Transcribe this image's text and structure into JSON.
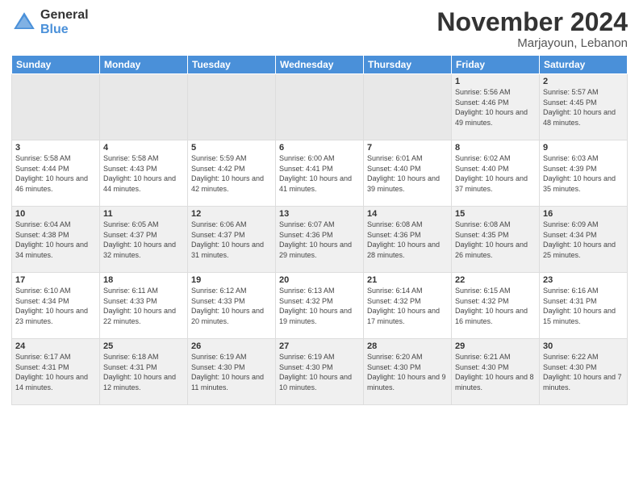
{
  "header": {
    "logo_general": "General",
    "logo_blue": "Blue",
    "month_title": "November 2024",
    "location": "Marjayoun, Lebanon"
  },
  "days_of_week": [
    "Sunday",
    "Monday",
    "Tuesday",
    "Wednesday",
    "Thursday",
    "Friday",
    "Saturday"
  ],
  "weeks": [
    [
      {
        "day": "",
        "empty": true
      },
      {
        "day": "",
        "empty": true
      },
      {
        "day": "",
        "empty": true
      },
      {
        "day": "",
        "empty": true
      },
      {
        "day": "",
        "empty": true
      },
      {
        "day": "1",
        "sunrise": "Sunrise: 5:56 AM",
        "sunset": "Sunset: 4:46 PM",
        "daylight": "Daylight: 10 hours and 49 minutes."
      },
      {
        "day": "2",
        "sunrise": "Sunrise: 5:57 AM",
        "sunset": "Sunset: 4:45 PM",
        "daylight": "Daylight: 10 hours and 48 minutes."
      }
    ],
    [
      {
        "day": "3",
        "sunrise": "Sunrise: 5:58 AM",
        "sunset": "Sunset: 4:44 PM",
        "daylight": "Daylight: 10 hours and 46 minutes."
      },
      {
        "day": "4",
        "sunrise": "Sunrise: 5:58 AM",
        "sunset": "Sunset: 4:43 PM",
        "daylight": "Daylight: 10 hours and 44 minutes."
      },
      {
        "day": "5",
        "sunrise": "Sunrise: 5:59 AM",
        "sunset": "Sunset: 4:42 PM",
        "daylight": "Daylight: 10 hours and 42 minutes."
      },
      {
        "day": "6",
        "sunrise": "Sunrise: 6:00 AM",
        "sunset": "Sunset: 4:41 PM",
        "daylight": "Daylight: 10 hours and 41 minutes."
      },
      {
        "day": "7",
        "sunrise": "Sunrise: 6:01 AM",
        "sunset": "Sunset: 4:40 PM",
        "daylight": "Daylight: 10 hours and 39 minutes."
      },
      {
        "day": "8",
        "sunrise": "Sunrise: 6:02 AM",
        "sunset": "Sunset: 4:40 PM",
        "daylight": "Daylight: 10 hours and 37 minutes."
      },
      {
        "day": "9",
        "sunrise": "Sunrise: 6:03 AM",
        "sunset": "Sunset: 4:39 PM",
        "daylight": "Daylight: 10 hours and 35 minutes."
      }
    ],
    [
      {
        "day": "10",
        "sunrise": "Sunrise: 6:04 AM",
        "sunset": "Sunset: 4:38 PM",
        "daylight": "Daylight: 10 hours and 34 minutes."
      },
      {
        "day": "11",
        "sunrise": "Sunrise: 6:05 AM",
        "sunset": "Sunset: 4:37 PM",
        "daylight": "Daylight: 10 hours and 32 minutes."
      },
      {
        "day": "12",
        "sunrise": "Sunrise: 6:06 AM",
        "sunset": "Sunset: 4:37 PM",
        "daylight": "Daylight: 10 hours and 31 minutes."
      },
      {
        "day": "13",
        "sunrise": "Sunrise: 6:07 AM",
        "sunset": "Sunset: 4:36 PM",
        "daylight": "Daylight: 10 hours and 29 minutes."
      },
      {
        "day": "14",
        "sunrise": "Sunrise: 6:08 AM",
        "sunset": "Sunset: 4:36 PM",
        "daylight": "Daylight: 10 hours and 28 minutes."
      },
      {
        "day": "15",
        "sunrise": "Sunrise: 6:08 AM",
        "sunset": "Sunset: 4:35 PM",
        "daylight": "Daylight: 10 hours and 26 minutes."
      },
      {
        "day": "16",
        "sunrise": "Sunrise: 6:09 AM",
        "sunset": "Sunset: 4:34 PM",
        "daylight": "Daylight: 10 hours and 25 minutes."
      }
    ],
    [
      {
        "day": "17",
        "sunrise": "Sunrise: 6:10 AM",
        "sunset": "Sunset: 4:34 PM",
        "daylight": "Daylight: 10 hours and 23 minutes."
      },
      {
        "day": "18",
        "sunrise": "Sunrise: 6:11 AM",
        "sunset": "Sunset: 4:33 PM",
        "daylight": "Daylight: 10 hours and 22 minutes."
      },
      {
        "day": "19",
        "sunrise": "Sunrise: 6:12 AM",
        "sunset": "Sunset: 4:33 PM",
        "daylight": "Daylight: 10 hours and 20 minutes."
      },
      {
        "day": "20",
        "sunrise": "Sunrise: 6:13 AM",
        "sunset": "Sunset: 4:32 PM",
        "daylight": "Daylight: 10 hours and 19 minutes."
      },
      {
        "day": "21",
        "sunrise": "Sunrise: 6:14 AM",
        "sunset": "Sunset: 4:32 PM",
        "daylight": "Daylight: 10 hours and 17 minutes."
      },
      {
        "day": "22",
        "sunrise": "Sunrise: 6:15 AM",
        "sunset": "Sunset: 4:32 PM",
        "daylight": "Daylight: 10 hours and 16 minutes."
      },
      {
        "day": "23",
        "sunrise": "Sunrise: 6:16 AM",
        "sunset": "Sunset: 4:31 PM",
        "daylight": "Daylight: 10 hours and 15 minutes."
      }
    ],
    [
      {
        "day": "24",
        "sunrise": "Sunrise: 6:17 AM",
        "sunset": "Sunset: 4:31 PM",
        "daylight": "Daylight: 10 hours and 14 minutes."
      },
      {
        "day": "25",
        "sunrise": "Sunrise: 6:18 AM",
        "sunset": "Sunset: 4:31 PM",
        "daylight": "Daylight: 10 hours and 12 minutes."
      },
      {
        "day": "26",
        "sunrise": "Sunrise: 6:19 AM",
        "sunset": "Sunset: 4:30 PM",
        "daylight": "Daylight: 10 hours and 11 minutes."
      },
      {
        "day": "27",
        "sunrise": "Sunrise: 6:19 AM",
        "sunset": "Sunset: 4:30 PM",
        "daylight": "Daylight: 10 hours and 10 minutes."
      },
      {
        "day": "28",
        "sunrise": "Sunrise: 6:20 AM",
        "sunset": "Sunset: 4:30 PM",
        "daylight": "Daylight: 10 hours and 9 minutes."
      },
      {
        "day": "29",
        "sunrise": "Sunrise: 6:21 AM",
        "sunset": "Sunset: 4:30 PM",
        "daylight": "Daylight: 10 hours and 8 minutes."
      },
      {
        "day": "30",
        "sunrise": "Sunrise: 6:22 AM",
        "sunset": "Sunset: 4:30 PM",
        "daylight": "Daylight: 10 hours and 7 minutes."
      }
    ]
  ]
}
